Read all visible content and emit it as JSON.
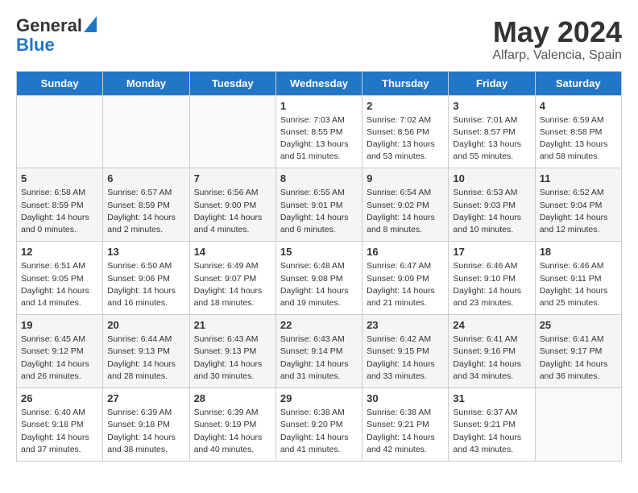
{
  "header": {
    "logo_line1": "General",
    "logo_line2": "Blue",
    "month_title": "May 2024",
    "location": "Alfarp, Valencia, Spain"
  },
  "days_of_week": [
    "Sunday",
    "Monday",
    "Tuesday",
    "Wednesday",
    "Thursday",
    "Friday",
    "Saturday"
  ],
  "weeks": [
    [
      {
        "day": "",
        "info": ""
      },
      {
        "day": "",
        "info": ""
      },
      {
        "day": "",
        "info": ""
      },
      {
        "day": "1",
        "info": "Sunrise: 7:03 AM\nSunset: 8:55 PM\nDaylight: 13 hours\nand 51 minutes."
      },
      {
        "day": "2",
        "info": "Sunrise: 7:02 AM\nSunset: 8:56 PM\nDaylight: 13 hours\nand 53 minutes."
      },
      {
        "day": "3",
        "info": "Sunrise: 7:01 AM\nSunset: 8:57 PM\nDaylight: 13 hours\nand 55 minutes."
      },
      {
        "day": "4",
        "info": "Sunrise: 6:59 AM\nSunset: 8:58 PM\nDaylight: 13 hours\nand 58 minutes."
      }
    ],
    [
      {
        "day": "5",
        "info": "Sunrise: 6:58 AM\nSunset: 8:59 PM\nDaylight: 14 hours\nand 0 minutes."
      },
      {
        "day": "6",
        "info": "Sunrise: 6:57 AM\nSunset: 8:59 PM\nDaylight: 14 hours\nand 2 minutes."
      },
      {
        "day": "7",
        "info": "Sunrise: 6:56 AM\nSunset: 9:00 PM\nDaylight: 14 hours\nand 4 minutes."
      },
      {
        "day": "8",
        "info": "Sunrise: 6:55 AM\nSunset: 9:01 PM\nDaylight: 14 hours\nand 6 minutes."
      },
      {
        "day": "9",
        "info": "Sunrise: 6:54 AM\nSunset: 9:02 PM\nDaylight: 14 hours\nand 8 minutes."
      },
      {
        "day": "10",
        "info": "Sunrise: 6:53 AM\nSunset: 9:03 PM\nDaylight: 14 hours\nand 10 minutes."
      },
      {
        "day": "11",
        "info": "Sunrise: 6:52 AM\nSunset: 9:04 PM\nDaylight: 14 hours\nand 12 minutes."
      }
    ],
    [
      {
        "day": "12",
        "info": "Sunrise: 6:51 AM\nSunset: 9:05 PM\nDaylight: 14 hours\nand 14 minutes."
      },
      {
        "day": "13",
        "info": "Sunrise: 6:50 AM\nSunset: 9:06 PM\nDaylight: 14 hours\nand 16 minutes."
      },
      {
        "day": "14",
        "info": "Sunrise: 6:49 AM\nSunset: 9:07 PM\nDaylight: 14 hours\nand 18 minutes."
      },
      {
        "day": "15",
        "info": "Sunrise: 6:48 AM\nSunset: 9:08 PM\nDaylight: 14 hours\nand 19 minutes."
      },
      {
        "day": "16",
        "info": "Sunrise: 6:47 AM\nSunset: 9:09 PM\nDaylight: 14 hours\nand 21 minutes."
      },
      {
        "day": "17",
        "info": "Sunrise: 6:46 AM\nSunset: 9:10 PM\nDaylight: 14 hours\nand 23 minutes."
      },
      {
        "day": "18",
        "info": "Sunrise: 6:46 AM\nSunset: 9:11 PM\nDaylight: 14 hours\nand 25 minutes."
      }
    ],
    [
      {
        "day": "19",
        "info": "Sunrise: 6:45 AM\nSunset: 9:12 PM\nDaylight: 14 hours\nand 26 minutes."
      },
      {
        "day": "20",
        "info": "Sunrise: 6:44 AM\nSunset: 9:13 PM\nDaylight: 14 hours\nand 28 minutes."
      },
      {
        "day": "21",
        "info": "Sunrise: 6:43 AM\nSunset: 9:13 PM\nDaylight: 14 hours\nand 30 minutes."
      },
      {
        "day": "22",
        "info": "Sunrise: 6:43 AM\nSunset: 9:14 PM\nDaylight: 14 hours\nand 31 minutes."
      },
      {
        "day": "23",
        "info": "Sunrise: 6:42 AM\nSunset: 9:15 PM\nDaylight: 14 hours\nand 33 minutes."
      },
      {
        "day": "24",
        "info": "Sunrise: 6:41 AM\nSunset: 9:16 PM\nDaylight: 14 hours\nand 34 minutes."
      },
      {
        "day": "25",
        "info": "Sunrise: 6:41 AM\nSunset: 9:17 PM\nDaylight: 14 hours\nand 36 minutes."
      }
    ],
    [
      {
        "day": "26",
        "info": "Sunrise: 6:40 AM\nSunset: 9:18 PM\nDaylight: 14 hours\nand 37 minutes."
      },
      {
        "day": "27",
        "info": "Sunrise: 6:39 AM\nSunset: 9:18 PM\nDaylight: 14 hours\nand 38 minutes."
      },
      {
        "day": "28",
        "info": "Sunrise: 6:39 AM\nSunset: 9:19 PM\nDaylight: 14 hours\nand 40 minutes."
      },
      {
        "day": "29",
        "info": "Sunrise: 6:38 AM\nSunset: 9:20 PM\nDaylight: 14 hours\nand 41 minutes."
      },
      {
        "day": "30",
        "info": "Sunrise: 6:38 AM\nSunset: 9:21 PM\nDaylight: 14 hours\nand 42 minutes."
      },
      {
        "day": "31",
        "info": "Sunrise: 6:37 AM\nSunset: 9:21 PM\nDaylight: 14 hours\nand 43 minutes."
      },
      {
        "day": "",
        "info": ""
      }
    ]
  ]
}
